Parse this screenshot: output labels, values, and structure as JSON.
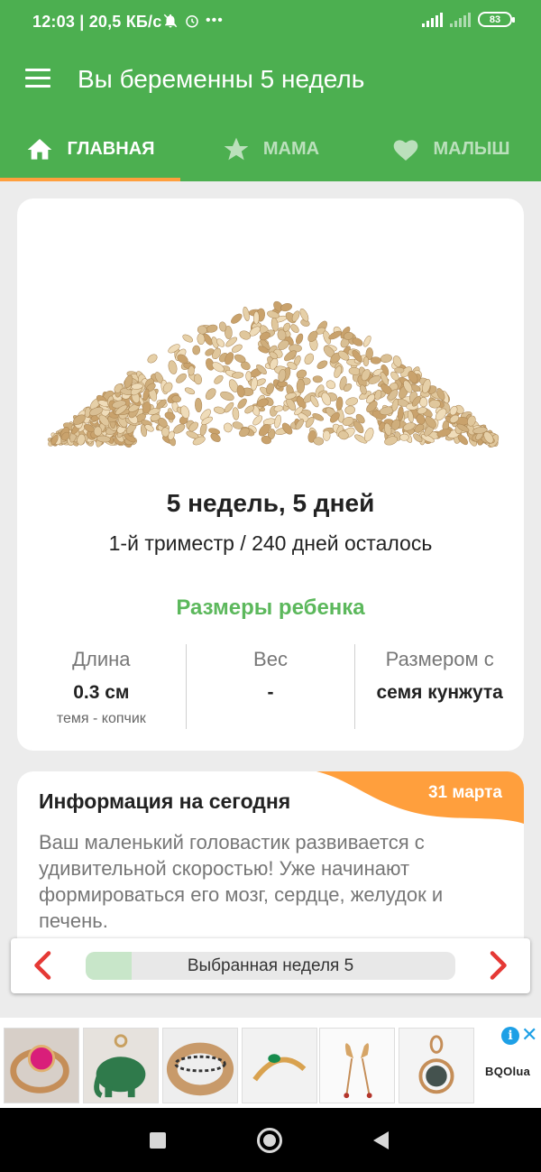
{
  "status_bar": {
    "time": "12:03",
    "speed": "20,5 КБ/с",
    "battery": "83",
    "icons": [
      "mute-notifications-icon",
      "alarm-icon",
      "more-dots-icon",
      "signal-icon",
      "signal-icon"
    ]
  },
  "app_bar": {
    "title": "Вы беременны 5 недель",
    "menu_icon": "hamburger-icon"
  },
  "tabs": [
    {
      "label": "ГЛАВНАЯ",
      "icon": "home-icon",
      "active": true
    },
    {
      "label": "МАМА",
      "icon": "star-icon",
      "active": false
    },
    {
      "label": "МАЛЫШ",
      "icon": "heart-icon",
      "active": false
    }
  ],
  "summary": {
    "image": "sesame-seeds-pile",
    "week_text": "5 недель, 5 дней",
    "trimester_text": "1-й триместр / 240 дней осталось",
    "sizes_title": "Размеры ребенка",
    "metrics": [
      {
        "label": "Длина",
        "value": "0.3 см",
        "sub": "темя - копчик"
      },
      {
        "label": "Вес",
        "value": "-",
        "sub": ""
      },
      {
        "label": "Размером с",
        "value": "семя кунжута",
        "sub": ""
      }
    ]
  },
  "info": {
    "title": "Информация на сегодня",
    "date": "31 марта",
    "body": "Ваш маленький головастик развивается с удивительной скоростью! Уже начинают формироваться его мозг, сердце, желудок и печень."
  },
  "week_selector": {
    "label": "Выбранная неделя 5",
    "progress": 0.125,
    "prev_icon": "chevron-left-icon",
    "next_icon": "chevron-right-icon"
  },
  "ad": {
    "brand": "BQOlua",
    "items": [
      "ring-with-ruby",
      "jade-elephant-pendant",
      "patterned-gold-ring",
      "emerald-gold-ring",
      "gold-hearts-earrings",
      "gold-pendant-with-stone"
    ]
  },
  "colors": {
    "primary_green": "#4caf50",
    "accent_orange": "#ff9f3d",
    "title_green": "#5cb85c",
    "arrow_red": "#e53935",
    "progress_fill": "#c8e6c9"
  }
}
